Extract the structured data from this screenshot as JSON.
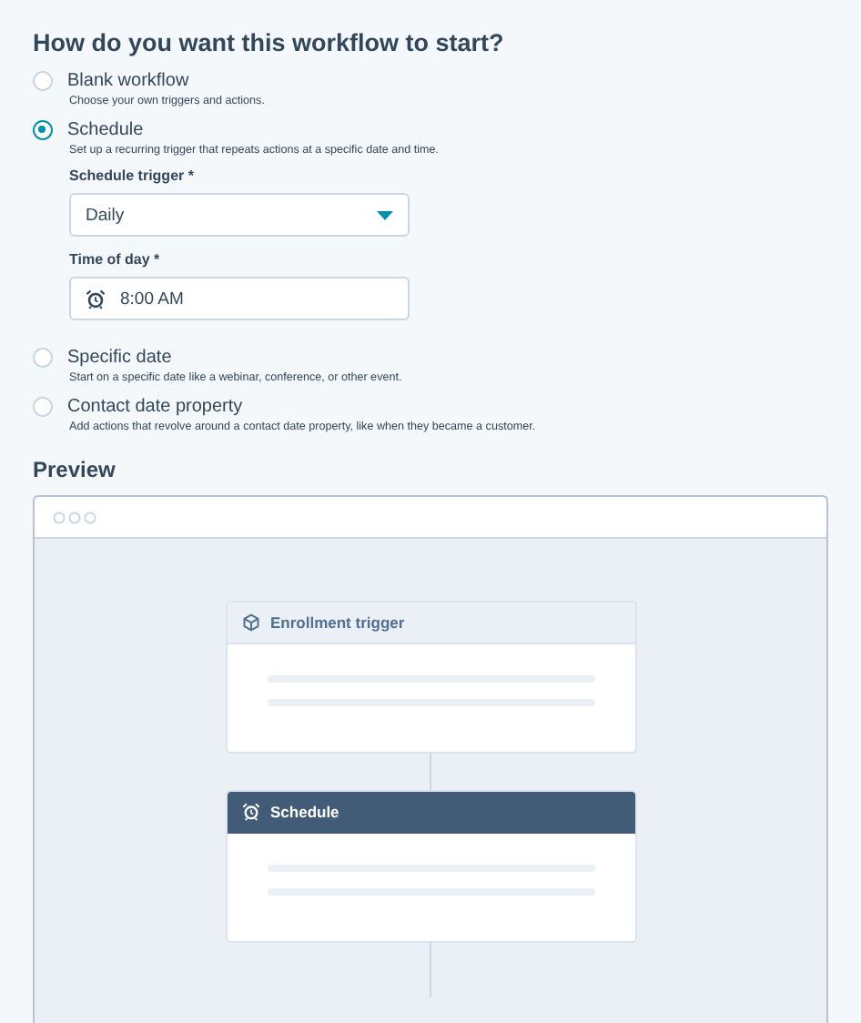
{
  "heading": "How do you want this workflow to start?",
  "options": [
    {
      "label": "Blank workflow",
      "description": "Choose your own triggers and actions.",
      "selected": false
    },
    {
      "label": "Schedule",
      "description": "Set up a recurring trigger that repeats actions at a specific date and time.",
      "selected": true,
      "fields": [
        {
          "kind": "select",
          "label": "Schedule trigger *",
          "value": "Daily"
        },
        {
          "kind": "time",
          "label": "Time of day *",
          "value": "8:00 AM"
        }
      ]
    },
    {
      "label": "Specific date",
      "description": "Start on a specific date like a webinar, conference, or other event.",
      "selected": false
    },
    {
      "label": "Contact date property",
      "description": "Add actions that revolve around a contact date property, like when they became a customer.",
      "selected": false
    }
  ],
  "preview": {
    "title": "Preview",
    "nodes": [
      {
        "kind": "enrollment",
        "title": "Enrollment trigger",
        "highlighted": false
      },
      {
        "kind": "schedule",
        "title": "Schedule",
        "highlighted": true
      }
    ]
  }
}
